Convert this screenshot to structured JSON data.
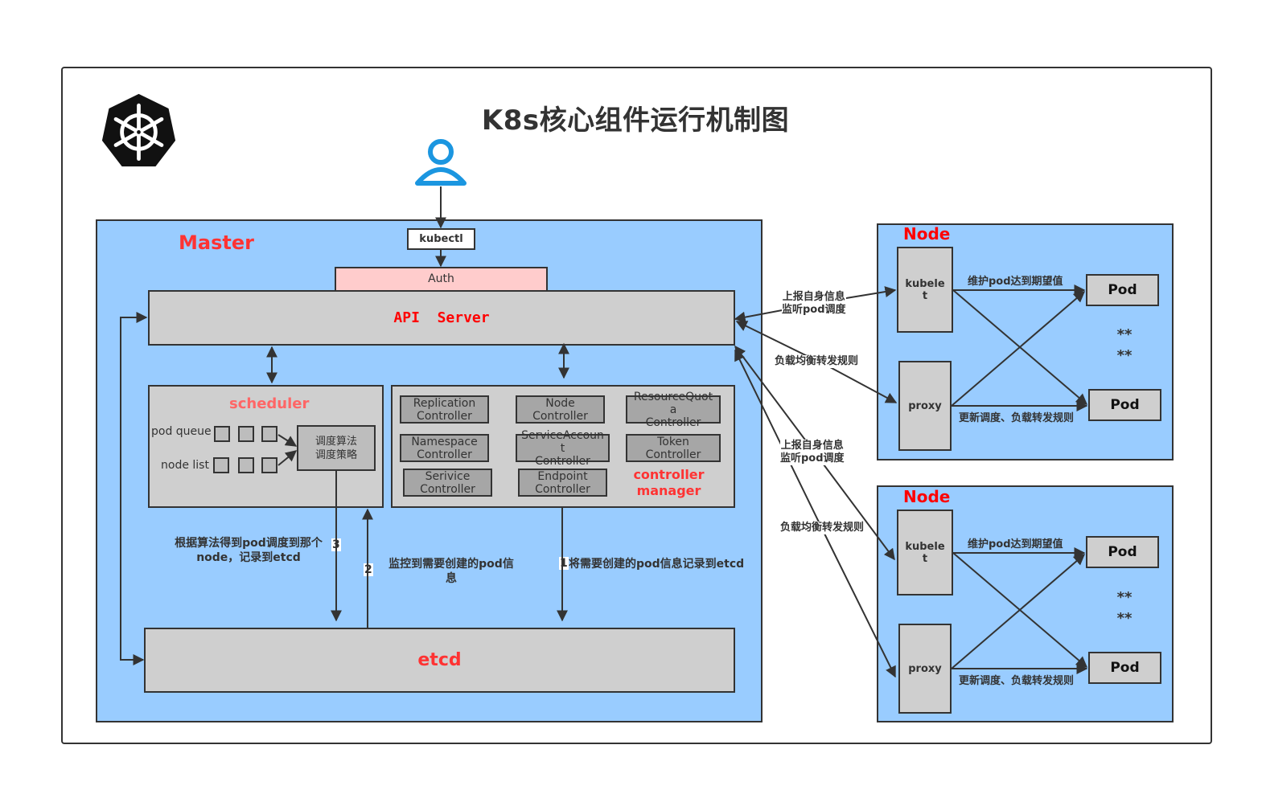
{
  "title": "K8s核心组件运行机制图",
  "logo": {
    "icon": "kubernetes-helm-icon"
  },
  "user": {
    "icon": "user-icon"
  },
  "master": {
    "label": "Master",
    "kubectl": "kubectl",
    "auth": "Auth",
    "api_server": "API  Server",
    "scheduler": {
      "label": "scheduler",
      "pod_queue": "pod queue",
      "node_list": "node list",
      "algorithm": [
        "调度算法",
        "调度策略"
      ]
    },
    "controller_manager": {
      "label": [
        "controller",
        "manager"
      ],
      "controllers": [
        [
          "Replication",
          "Controller"
        ],
        [
          "Node",
          "Controller"
        ],
        [
          "ResourceQuot",
          "a",
          "Controller"
        ],
        [
          "Namespace",
          "Controller"
        ],
        [
          "ServiceAccoun",
          "t",
          "Controller"
        ],
        [
          "Token",
          "Controller"
        ],
        [
          "Serivice",
          "Controller"
        ],
        [
          "Endpoint",
          "Controller"
        ]
      ]
    },
    "etcd": "etcd",
    "steps": [
      {
        "num": "1",
        "text": "将需要创建的pod信息记录到etcd"
      },
      {
        "num": "2",
        "text": "监控到需要创建的pod信息"
      },
      {
        "num": "3",
        "text": "根据算法得到pod调度到那个node，记录到etcd"
      }
    ]
  },
  "connections": {
    "kubelet_link": [
      "上报自身信息",
      "监听pod调度"
    ],
    "proxy_link": "负载均衡转发规则"
  },
  "nodes": [
    {
      "label": "Node",
      "kubelet": [
        "kubele",
        "t"
      ],
      "proxy": "proxy",
      "pods": [
        "Pod",
        "Pod"
      ],
      "ellipsis": [
        "**",
        "**"
      ],
      "kubelet_note": "维护pod达到期望值",
      "proxy_note": "更新调度、负载转发规则"
    },
    {
      "label": "Node",
      "kubelet": [
        "kubele",
        "t"
      ],
      "proxy": "proxy",
      "pods": [
        "Pod",
        "Pod"
      ],
      "ellipsis": [
        "**",
        "**"
      ],
      "kubelet_note": "维护pod达到期望值",
      "proxy_note": "更新调度、负载转发规则"
    }
  ],
  "colors": {
    "panel": "#99ccff",
    "component": "#cfcfcf",
    "controller": "#a6a6a6",
    "auth": "#ffcccc",
    "label_red": "#ff3333",
    "user_blue": "#1b96e0"
  }
}
